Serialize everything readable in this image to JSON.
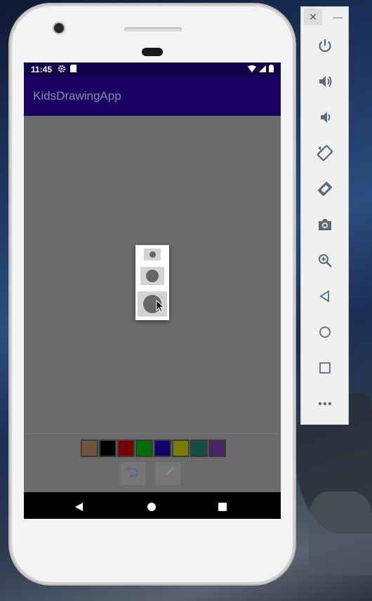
{
  "status_bar": {
    "time": "11:45"
  },
  "app": {
    "title": "KidsDrawingApp"
  },
  "palette": {
    "colors": [
      "#b38a60",
      "#000000",
      "#c00000",
      "#00b000",
      "#1a00b0",
      "#c8c800",
      "#208070",
      "#7a3aa0"
    ]
  },
  "tools": {
    "undo_icon": "undo-icon",
    "brush_icon": "brush-icon"
  },
  "brush_size_dialog": {
    "options": [
      "small",
      "medium",
      "large"
    ]
  },
  "emulator_panel": {
    "buttons": [
      "power",
      "volume-up",
      "volume-down",
      "rotate-left",
      "rotate-right",
      "screenshot",
      "zoom",
      "back",
      "home",
      "overview",
      "more"
    ]
  }
}
